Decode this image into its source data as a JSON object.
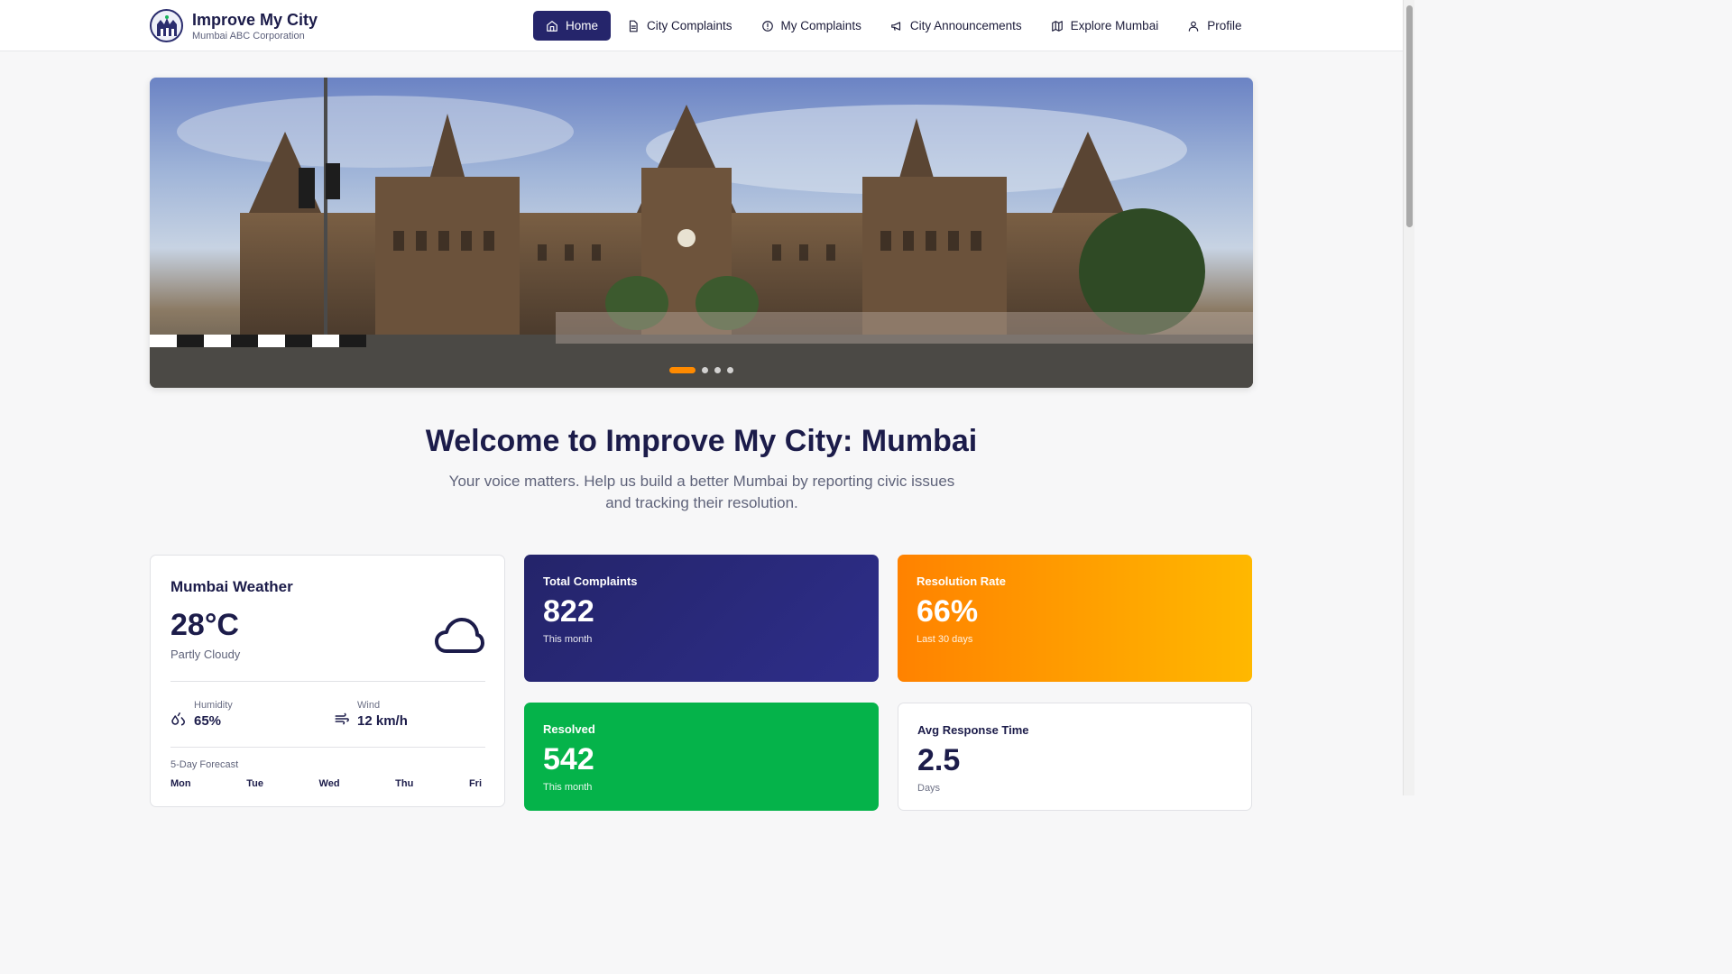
{
  "header": {
    "title": "Improve My City",
    "subtitle": "Mumbai ABC Corporation",
    "nav": [
      {
        "label": "Home",
        "icon": "home-icon",
        "active": true
      },
      {
        "label": "City Complaints",
        "icon": "document-icon"
      },
      {
        "label": "My Complaints",
        "icon": "alert-circle-icon"
      },
      {
        "label": "City Announcements",
        "icon": "megaphone-icon"
      },
      {
        "label": "Explore Mumbai",
        "icon": "map-icon"
      },
      {
        "label": "Profile",
        "icon": "user-icon"
      }
    ]
  },
  "hero": {
    "slides": 4,
    "active_slide": 1,
    "accent": "#ff8a00"
  },
  "welcome": {
    "title": "Welcome to Improve My City: Mumbai",
    "subtitle": "Your voice matters. Help us build a better Mumbai by reporting civic issues and tracking their resolution."
  },
  "weather": {
    "title": "Mumbai Weather",
    "temperature": "28°C",
    "condition": "Partly Cloudy",
    "condition_icon": "cloud-icon",
    "humidity_label": "Humidity",
    "humidity": "65%",
    "wind_label": "Wind",
    "wind": "12 km/h",
    "forecast_title": "5-Day Forecast",
    "forecast_days": [
      "Mon",
      "Tue",
      "Wed",
      "Thu",
      "Fri"
    ]
  },
  "stats": {
    "total": {
      "label": "Total Complaints",
      "value": "822",
      "note": "This month",
      "color": "#26266e"
    },
    "rate": {
      "label": "Resolution Rate",
      "value": "66%",
      "note": "Last 30 days",
      "color": "#ff8a00"
    },
    "resolved": {
      "label": "Resolved",
      "value": "542",
      "note": "This month",
      "color": "#05b34a"
    },
    "avg": {
      "label": "Avg Response Time",
      "value": "2.5",
      "note": "Days"
    }
  }
}
